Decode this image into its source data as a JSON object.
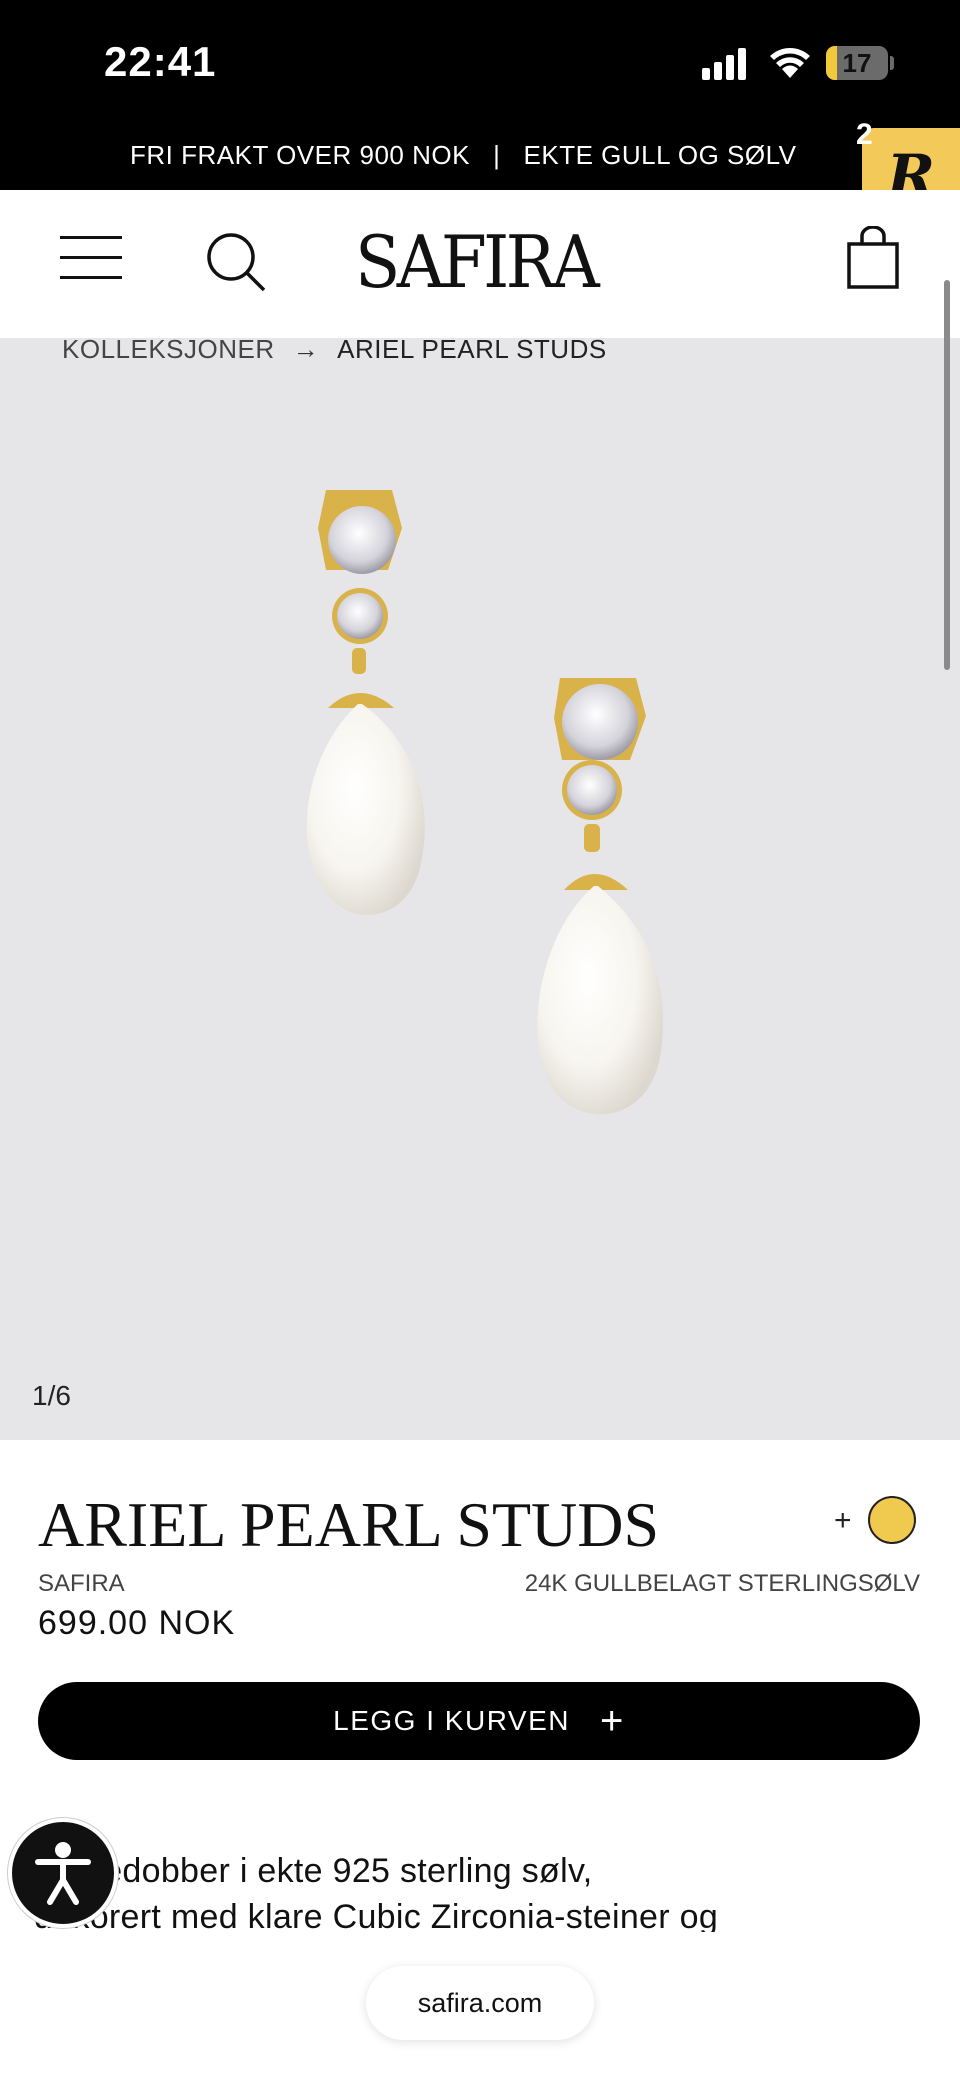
{
  "status_bar": {
    "time": "22:41",
    "battery": "17",
    "battery_level": 0.17
  },
  "announcement": {
    "text": "FRI FRAKT OVER 900 NOK   |   EKTE GULL OG SØLV"
  },
  "reviews_badge": {
    "letter": "R",
    "count": "2"
  },
  "header": {
    "logo": "SAFIRA",
    "menu_icon": "hamburger-menu-icon",
    "search_icon": "search-icon",
    "cart_icon": "shopping-bag-icon"
  },
  "breadcrumb": {
    "parent": "KOLLEKSJONER",
    "separator": "→",
    "current": "ARIEL PEARL STUDS"
  },
  "gallery": {
    "counter": "1/6"
  },
  "product": {
    "title": "ARIEL PEARL STUDS",
    "color_plus": "+",
    "swatch_color": "#f0c94f",
    "brand": "SAFIRA",
    "material": "24K GULLBELAGT STERLINGSØLV",
    "price": "699.00 NOK",
    "add_to_cart": "LEGG I KURVEN",
    "add_to_cart_icon": "+",
    "description_line1": "Øreredobber i ekte 925 sterling sølv,",
    "description_line2": "dekorert med klare Cubic Zirconia-steiner og"
  },
  "browser": {
    "url": "safira.com"
  },
  "colors": {
    "black": "#000000",
    "gallery_bg": "#e6e6e8",
    "gold": "#f0c94f"
  }
}
